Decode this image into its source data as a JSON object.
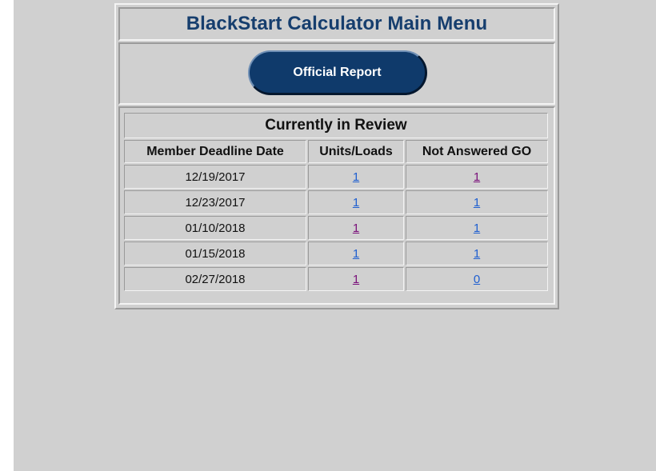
{
  "header": {
    "title": "BlackStart Calculator Main Menu"
  },
  "actions": {
    "official_report_label": "Official Report"
  },
  "review": {
    "caption": "Currently in Review",
    "columns": [
      "Member Deadline Date",
      "Units/Loads",
      "Not Answered GO"
    ],
    "rows": [
      {
        "date": "12/19/2017",
        "units_loads": "1",
        "not_answered_go": "1",
        "units_visited": false,
        "notans_visited": true
      },
      {
        "date": "12/23/2017",
        "units_loads": "1",
        "not_answered_go": "1",
        "units_visited": false,
        "notans_visited": false
      },
      {
        "date": "01/10/2018",
        "units_loads": "1",
        "not_answered_go": "1",
        "units_visited": true,
        "notans_visited": false
      },
      {
        "date": "01/15/2018",
        "units_loads": "1",
        "not_answered_go": "1",
        "units_visited": false,
        "notans_visited": false
      },
      {
        "date": "02/27/2018",
        "units_loads": "1",
        "not_answered_go": "0",
        "units_visited": true,
        "notans_visited": false
      }
    ]
  },
  "colors": {
    "background": "#d0d0d0",
    "title_text": "#163e6e",
    "button_fill": "#0f3a6b",
    "link_unvisited": "#1f5fd0",
    "link_visited": "#7a0f7a"
  }
}
